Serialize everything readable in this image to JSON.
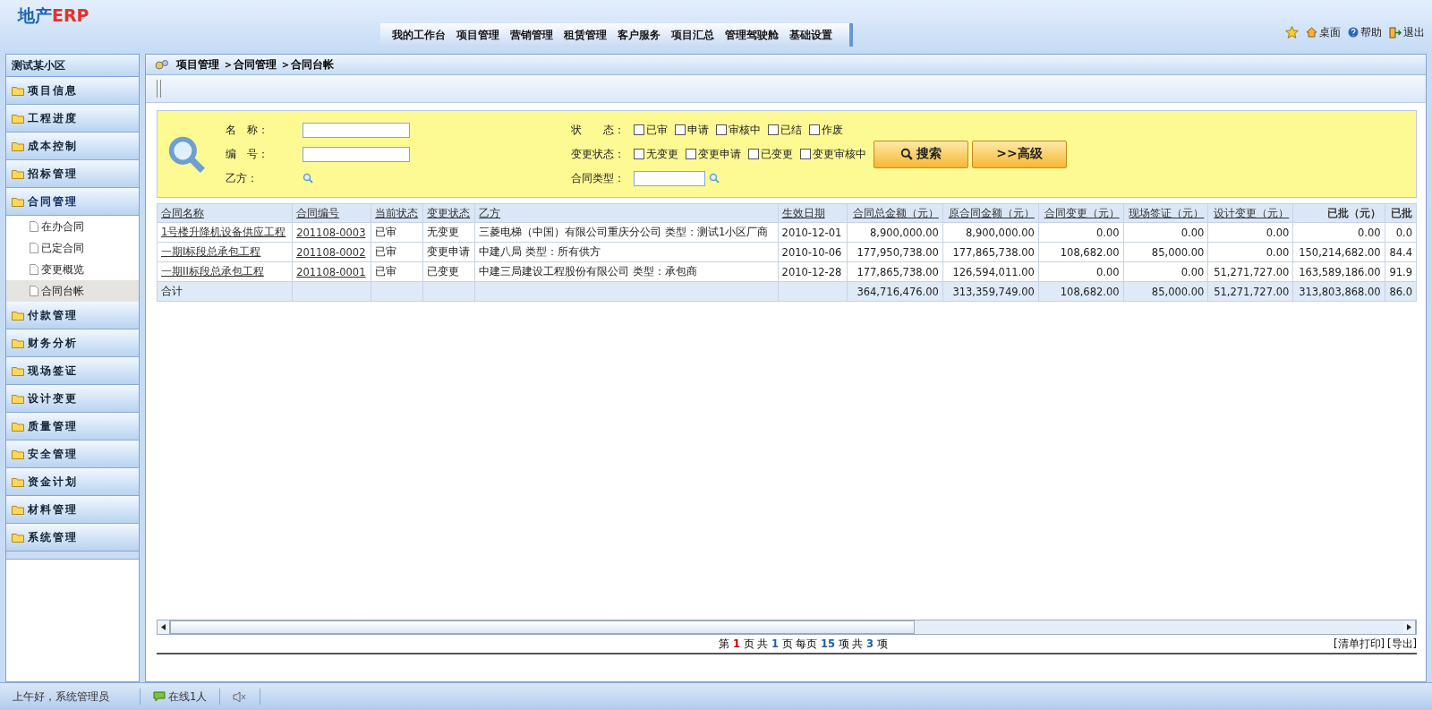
{
  "logo": {
    "main": "地产",
    "accent": "ERP"
  },
  "nav": {
    "items": [
      {
        "label": "我的工作台",
        "selected": false
      },
      {
        "label": "项目管理",
        "selected": false
      },
      {
        "label": "营销管理",
        "selected": false
      },
      {
        "label": "租赁管理",
        "selected": false
      },
      {
        "label": "客户服务",
        "selected": false
      },
      {
        "label": "项目汇总",
        "selected": false
      },
      {
        "label": "管理驾驶舱",
        "selected": false
      },
      {
        "label": "基础设置",
        "selected": false
      }
    ]
  },
  "header_links": [
    {
      "label": "桌面",
      "kind": "home"
    },
    {
      "label": "帮助",
      "kind": "help"
    },
    {
      "label": "退出",
      "kind": "exit"
    }
  ],
  "sidebar": {
    "title": "测试某小区",
    "items": [
      {
        "label": "项目信息",
        "expanded": false
      },
      {
        "label": "工程进度",
        "expanded": false
      },
      {
        "label": "成本控制",
        "expanded": false
      },
      {
        "label": "招标管理",
        "expanded": false
      },
      {
        "label": "合同管理",
        "expanded": true,
        "children": [
          {
            "label": "在办合同",
            "selected": false
          },
          {
            "label": "已定合同",
            "selected": false
          },
          {
            "label": "变更概览",
            "selected": false
          },
          {
            "label": "合同台帐",
            "selected": true
          }
        ]
      },
      {
        "label": "付款管理",
        "expanded": false
      },
      {
        "label": "财务分析",
        "expanded": false
      },
      {
        "label": "现场签证",
        "expanded": false
      },
      {
        "label": "设计变更",
        "expanded": false
      },
      {
        "label": "质量管理",
        "expanded": false
      },
      {
        "label": "安全管理",
        "expanded": false
      },
      {
        "label": "资金计划",
        "expanded": false
      },
      {
        "label": "材料管理",
        "expanded": false
      },
      {
        "label": "系统管理",
        "expanded": false
      }
    ]
  },
  "breadcrumb": "项目管理 ＞合同管理 ＞合同台帐",
  "filters": {
    "name_label": "名　称：",
    "number_label": "编　号：",
    "party_label": "乙方：",
    "status_label": "状　　态：",
    "status_options": [
      {
        "label": "已审",
        "checked": false
      },
      {
        "label": "申请",
        "checked": false
      },
      {
        "label": "审核中",
        "checked": false
      },
      {
        "label": "已结",
        "checked": false
      },
      {
        "label": "作废",
        "checked": false
      }
    ],
    "change_label": "变更状态：",
    "change_options": [
      {
        "label": "无变更",
        "checked": false
      },
      {
        "label": "变更申请",
        "checked": false
      },
      {
        "label": "已变更",
        "checked": false
      },
      {
        "label": "变更审核中",
        "checked": false
      }
    ],
    "type_label": "合同类型：",
    "buttons": [
      {
        "label": "搜索",
        "kind": "search"
      },
      {
        "label": ">>高级",
        "kind": "plain"
      }
    ]
  },
  "table": {
    "columns": [
      "合同名称",
      "合同编号",
      "当前状态",
      "变更状态",
      "乙方",
      "生效日期",
      "合同总金额（元）",
      "原合同金额（元）",
      "合同变更（元）",
      "现场签证（元）",
      "设计变更（元）",
      "已批（元）",
      "已批"
    ],
    "rows": [
      {
        "cells": [
          "1号楼升降机设备供应工程",
          "201108-0003",
          "已审",
          "无变更",
          "三菱电梯（中国）有限公司重庆分公司 类型：测试1小区厂商",
          "2010-12-01",
          "8,900,000.00",
          "8,900,000.00",
          "0.00",
          "0.00",
          "0.00",
          "0.00",
          "0.0"
        ]
      },
      {
        "cells": [
          "一期I标段总承包工程",
          "201108-0002",
          "已审",
          "变更申请",
          "中建八局 类型：所有供方",
          "2010-10-06",
          "177,950,738.00",
          "177,865,738.00",
          "108,682.00",
          "85,000.00",
          "0.00",
          "150,214,682.00",
          "84.4"
        ]
      },
      {
        "cells": [
          "一期II标段总承包工程",
          "201108-0001",
          "已审",
          "已变更",
          "中建三局建设工程股份有限公司 类型：承包商",
          "2010-12-28",
          "177,865,738.00",
          "126,594,011.00",
          "0.00",
          "0.00",
          "51,271,727.00",
          "163,589,186.00",
          "91.9"
        ]
      }
    ],
    "total": {
      "label": "合计",
      "values": [
        "364,716,476.00",
        "313,359,749.00",
        "108,682.00",
        "85,000.00",
        "51,271,727.00",
        "313,803,868.00",
        "86.0"
      ]
    }
  },
  "pager": "第 **1** 页 共 **1** 页 每页 **15** 项 共 **3** 项",
  "pager_links": [
    "[清单打印]",
    "[导出]"
  ],
  "status_bar": {
    "greeting": "上午好，系统管理员",
    "online": "在线1人"
  }
}
